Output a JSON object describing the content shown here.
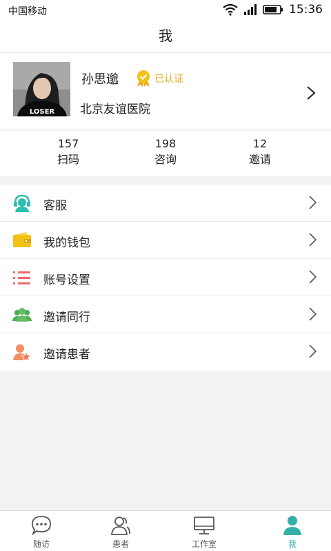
{
  "status_bar": {
    "carrier": "中国移动",
    "time": "15:36"
  },
  "header": {
    "title": "我"
  },
  "profile": {
    "name": "孙思邈",
    "verified_label": "已认证",
    "hospital": "北京友谊医院",
    "avatar_shirt_text": "LOSER"
  },
  "stats": [
    {
      "value": "157",
      "label": "扫码"
    },
    {
      "value": "198",
      "label": "咨询"
    },
    {
      "value": "12",
      "label": "邀请"
    }
  ],
  "menu": [
    {
      "label": "客服",
      "icon": "customer-service-icon",
      "color": "#2bbfae"
    },
    {
      "label": "我的钱包",
      "icon": "wallet-icon",
      "color": "#f2c316"
    },
    {
      "label": "账号设置",
      "icon": "settings-list-icon",
      "color": "#ee6a6a"
    },
    {
      "label": "邀请同行",
      "icon": "invite-colleagues-icon",
      "color": "#4caf50"
    },
    {
      "label": "邀请患者",
      "icon": "invite-patient-icon",
      "color": "#f58e63"
    }
  ],
  "tabs": [
    {
      "label": "随访",
      "icon": "chat-bubble-icon",
      "active": false
    },
    {
      "label": "患者",
      "icon": "patients-icon",
      "active": false
    },
    {
      "label": "工作室",
      "icon": "monitor-icon",
      "active": false
    },
    {
      "label": "我",
      "icon": "profile-icon",
      "active": true
    }
  ],
  "colors": {
    "accent": "#34b1a6",
    "verified": "#e9ad27",
    "background": "#f2f2f4"
  }
}
